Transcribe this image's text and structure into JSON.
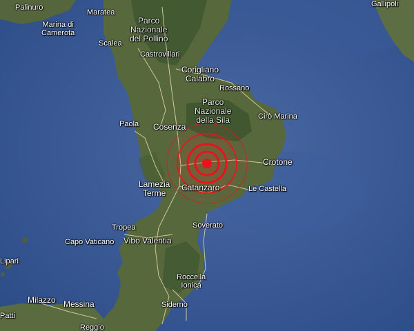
{
  "map": {
    "style": "satellite",
    "colors": {
      "sea_deep": "#2a4a86",
      "sea_shallow": "#4d6ea8",
      "land": "#56683c",
      "land_dark": "#3e5530",
      "road": "#e8d9a8",
      "epicenter": "#e8141a"
    },
    "labels": {
      "palinuro": "Palinuro",
      "maratea": "Maratea",
      "marina_di_camerota": "Marina di\nCamerota",
      "parco_pollino": "Parco\nNazionale\ndel Pollino",
      "scalea": "Scalea",
      "castrovillari": "Castrovillari",
      "corigliano": "Corigliano\nCalabro",
      "rossano": "Rossano",
      "parco_sila": "Parco\nNazionale\ndella Sila",
      "ciro_marina": "Cirò Marina",
      "paola": "Paola",
      "cosenza": "Cosenza",
      "crotone": "Crotone",
      "lamezia": "Lamezia\nTerme",
      "catanzaro": "Catanzaro",
      "le_castella": "Le Castella",
      "soverato": "Soverato",
      "tropea": "Tropea",
      "capo_vaticano": "Capo Vaticano",
      "vibo": "Vibo Valentia",
      "lipari": "Lipari",
      "roccella": "Roccella\nIonica",
      "milazzo": "Milazzo",
      "messina": "Messina",
      "siderno": "Siderno",
      "gallipoli": "Gallipoli",
      "patti": "Patti",
      "reggio": "Reggio"
    },
    "markers": {
      "epicenter": {
        "icon": "earthquake-epicenter-icon",
        "rings": 3
      }
    }
  }
}
